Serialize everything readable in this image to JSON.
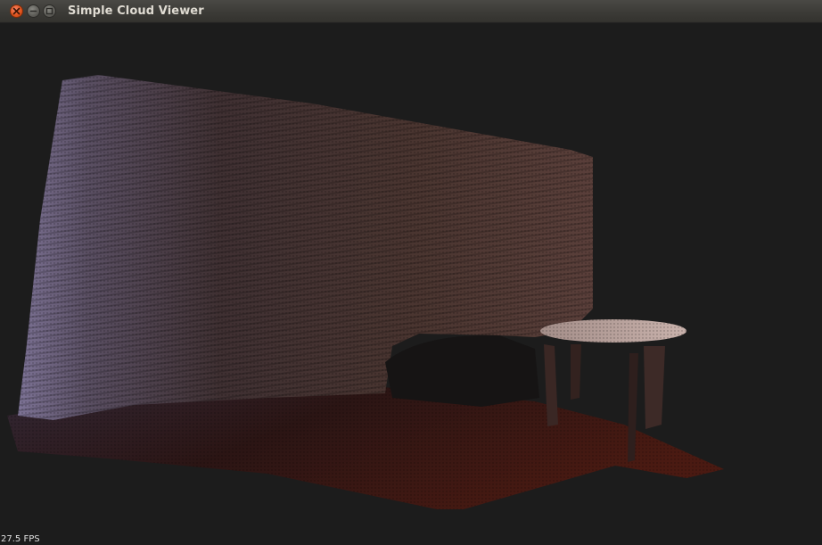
{
  "window": {
    "title": "Simple Cloud Viewer",
    "controls": {
      "close_icon": "close-icon",
      "minimize_icon": "minimize-icon",
      "maximize_icon": "maximize-icon"
    }
  },
  "viewer": {
    "background_color": "#1c1c1c",
    "fps_label": "27.5 FPS"
  }
}
